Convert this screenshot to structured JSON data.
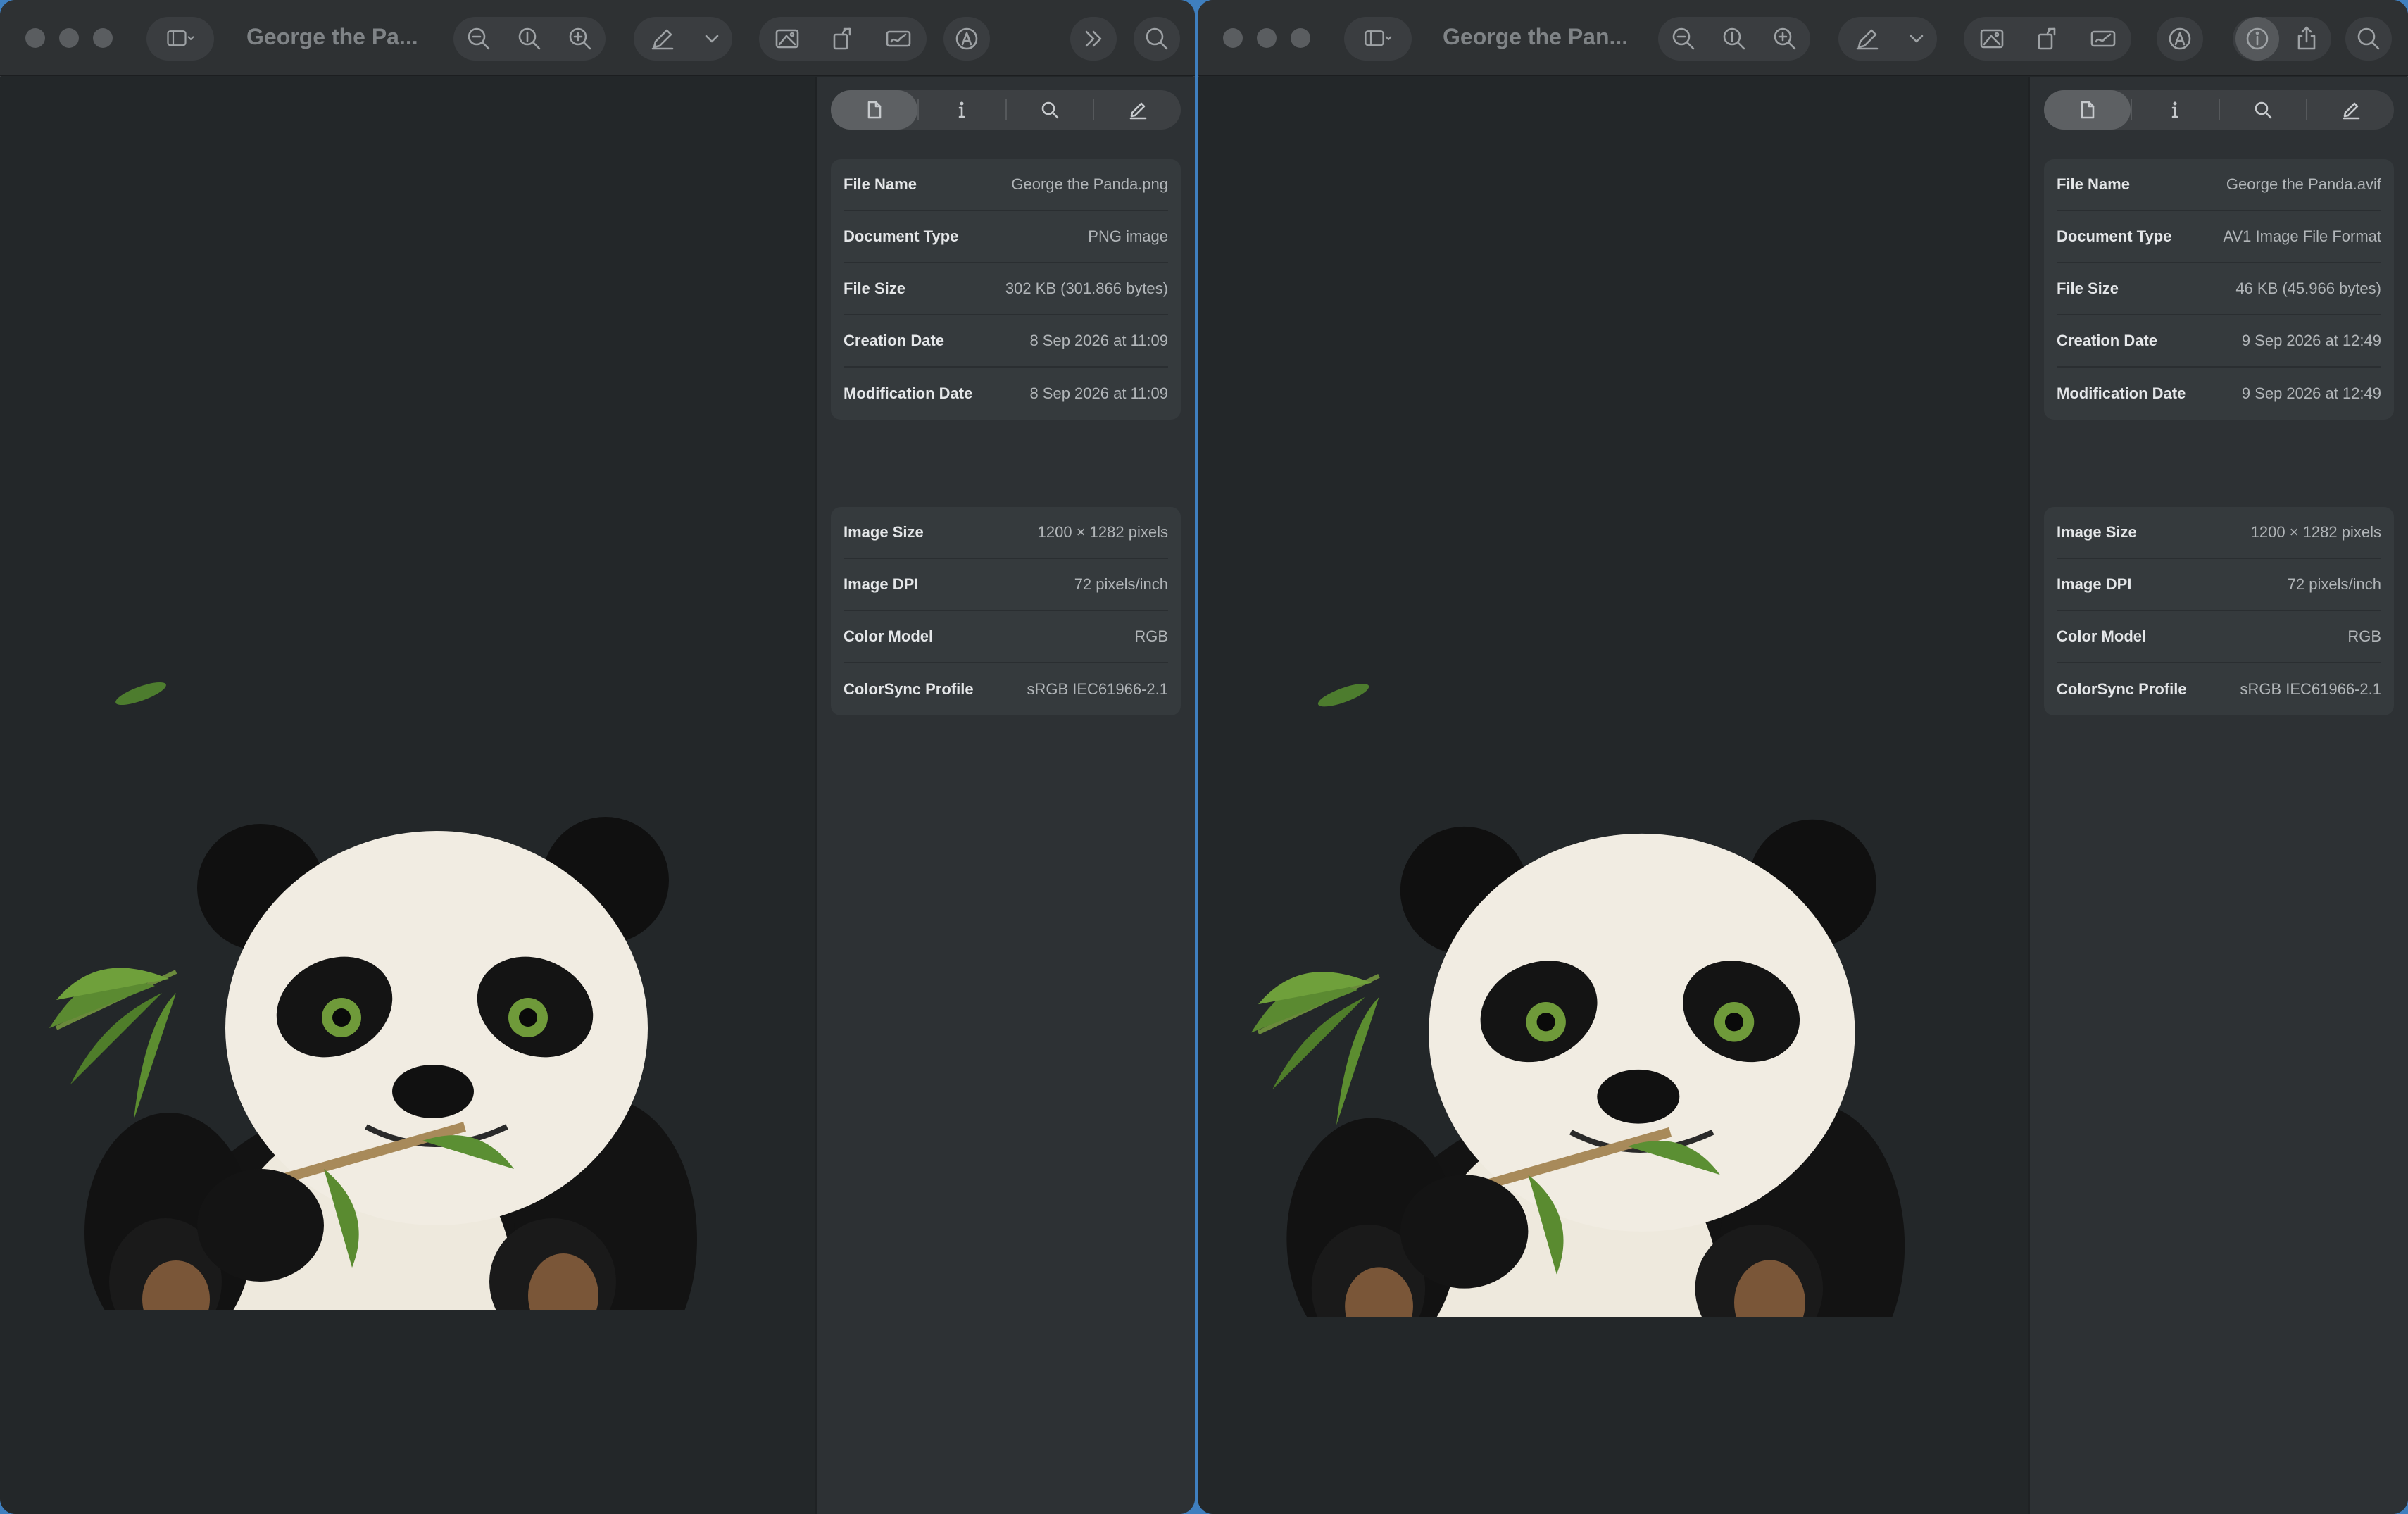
{
  "left_window": {
    "title": "George the Pa...",
    "inspector": {
      "file_info": [
        {
          "label": "File Name",
          "value": "George the Panda.png"
        },
        {
          "label": "Document Type",
          "value": "PNG image"
        },
        {
          "label": "File Size",
          "value": "302 KB (301.866 bytes)"
        },
        {
          "label": "Creation Date",
          "value": "8 Sep 2026 at 11:09"
        },
        {
          "label": "Modification Date",
          "value": "8 Sep 2026 at 11:09"
        }
      ],
      "image_info": [
        {
          "label": "Image Size",
          "value": "1200 × 1282 pixels"
        },
        {
          "label": "Image DPI",
          "value": "72 pixels/inch"
        },
        {
          "label": "Color Model",
          "value": "RGB"
        },
        {
          "label": "ColorSync Profile",
          "value": "sRGB IEC61966-2.1"
        }
      ]
    }
  },
  "right_window": {
    "title": "George the Pan...",
    "inspector": {
      "file_info": [
        {
          "label": "File Name",
          "value": "George the Panda.avif"
        },
        {
          "label": "Document Type",
          "value": "AV1 Image File Format"
        },
        {
          "label": "File Size",
          "value": "46 KB (45.966 bytes)"
        },
        {
          "label": "Creation Date",
          "value": "9 Sep 2026 at 12:49"
        },
        {
          "label": "Modification Date",
          "value": "9 Sep 2026 at 12:49"
        }
      ],
      "image_info": [
        {
          "label": "Image Size",
          "value": "1200 × 1282 pixels"
        },
        {
          "label": "Image DPI",
          "value": "72 pixels/inch"
        },
        {
          "label": "Color Model",
          "value": "RGB"
        },
        {
          "label": "ColorSync Profile",
          "value": "sRGB IEC61966-2.1"
        }
      ]
    }
  },
  "inspector_tabs": [
    {
      "name": "general-tab",
      "icon": "document-icon"
    },
    {
      "name": "more-info-tab",
      "icon": "info-icon"
    },
    {
      "name": "search-tab",
      "icon": "magnifier-icon"
    },
    {
      "name": "annotations-tab",
      "icon": "pencil-icon"
    }
  ],
  "colors": {
    "window_bg": "#232729",
    "inspector_bg": "#2d3134",
    "card_bg": "#353a3d",
    "desktop": "#3f7fbf"
  }
}
